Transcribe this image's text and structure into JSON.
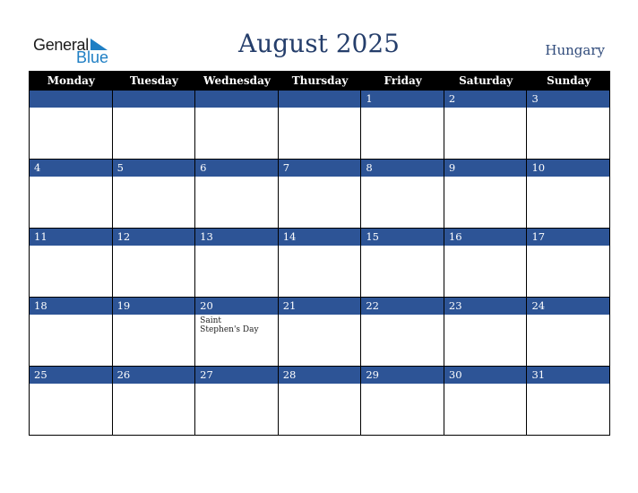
{
  "logo": {
    "line1": "General",
    "line2": "Blue"
  },
  "title": "August 2025",
  "country": "Hungary",
  "weekdays": [
    "Monday",
    "Tuesday",
    "Wednesday",
    "Thursday",
    "Friday",
    "Saturday",
    "Sunday"
  ],
  "weeks": [
    [
      {
        "day": "",
        "note": ""
      },
      {
        "day": "",
        "note": ""
      },
      {
        "day": "",
        "note": ""
      },
      {
        "day": "",
        "note": ""
      },
      {
        "day": "1",
        "note": ""
      },
      {
        "day": "2",
        "note": ""
      },
      {
        "day": "3",
        "note": ""
      }
    ],
    [
      {
        "day": "4",
        "note": ""
      },
      {
        "day": "5",
        "note": ""
      },
      {
        "day": "6",
        "note": ""
      },
      {
        "day": "7",
        "note": ""
      },
      {
        "day": "8",
        "note": ""
      },
      {
        "day": "9",
        "note": ""
      },
      {
        "day": "10",
        "note": ""
      }
    ],
    [
      {
        "day": "11",
        "note": ""
      },
      {
        "day": "12",
        "note": ""
      },
      {
        "day": "13",
        "note": ""
      },
      {
        "day": "14",
        "note": ""
      },
      {
        "day": "15",
        "note": ""
      },
      {
        "day": "16",
        "note": ""
      },
      {
        "day": "17",
        "note": ""
      }
    ],
    [
      {
        "day": "18",
        "note": ""
      },
      {
        "day": "19",
        "note": ""
      },
      {
        "day": "20",
        "note": "Saint Stephen's Day"
      },
      {
        "day": "21",
        "note": ""
      },
      {
        "day": "22",
        "note": ""
      },
      {
        "day": "23",
        "note": ""
      },
      {
        "day": "24",
        "note": ""
      }
    ],
    [
      {
        "day": "25",
        "note": ""
      },
      {
        "day": "26",
        "note": ""
      },
      {
        "day": "27",
        "note": ""
      },
      {
        "day": "28",
        "note": ""
      },
      {
        "day": "29",
        "note": ""
      },
      {
        "day": "30",
        "note": ""
      },
      {
        "day": "31",
        "note": ""
      }
    ]
  ],
  "colors": {
    "date_bar": "#2d5496",
    "header_bg": "#000000",
    "title": "#253e6b",
    "brand_blue": "#1f7fc4"
  }
}
